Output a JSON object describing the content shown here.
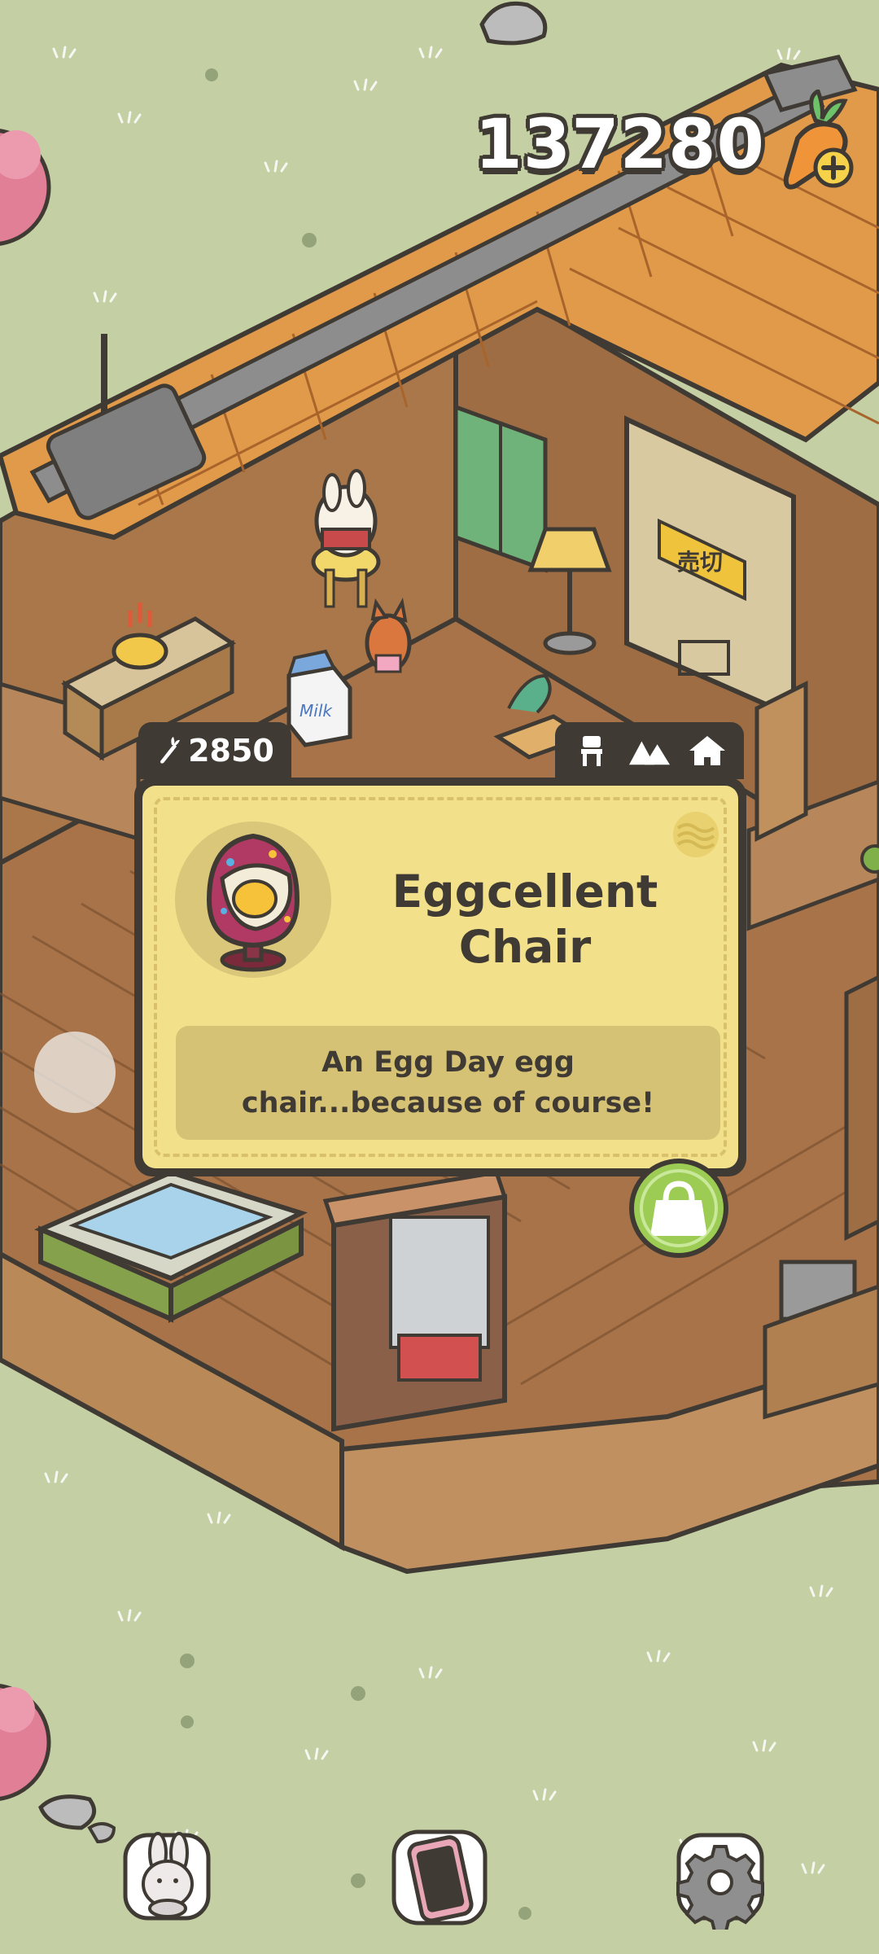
{
  "hud": {
    "carrot_count": "137280",
    "add_carrots_icon": "carrot-plus-icon"
  },
  "item_card": {
    "price": "2850",
    "price_icon": "carrot-icon",
    "category_icons": [
      "chair-icon",
      "mountain-icon",
      "house-icon"
    ],
    "name": "Eggcellent Chair",
    "description": "An Egg Day egg chair...because of course!",
    "buy_icon": "shopping-bag-icon",
    "colors": {
      "card": "#f2e08a",
      "border": "#3f3a33",
      "description_box": "#d6c274",
      "buy_button": "#9ccc54"
    }
  },
  "furniture_labels": {
    "milk_carton": "Milk",
    "sign": "売切"
  },
  "bottom_bar": {
    "left_icon": "bunny-icon",
    "center_icon": "phone-icon",
    "right_icon": "gear-icon"
  }
}
